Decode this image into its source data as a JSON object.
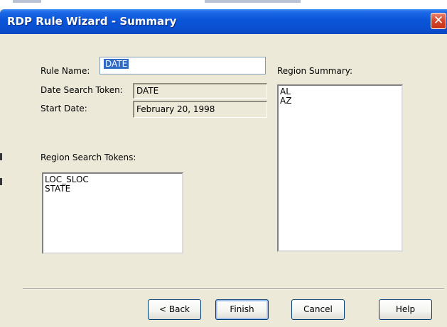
{
  "dialog": {
    "title": "RDP Rule Wizard - Summary",
    "close_glyph": "✕",
    "close_icon": "close-icon"
  },
  "fields": {
    "rule_name_label": "Rule Name:",
    "rule_name_value": "DATE",
    "date_search_token_label": "Date Search Token:",
    "date_search_token_value": "DATE",
    "start_date_label": "Start Date:",
    "start_date_value": "February 20, 1998"
  },
  "region_search_tokens": {
    "label": "Region Search Tokens:",
    "items": [
      "LOC_SLOC",
      "STATE"
    ]
  },
  "region_summary": {
    "label": "Region Summary:",
    "items": [
      "AL",
      "AZ"
    ]
  },
  "buttons": {
    "back": "< Back",
    "finish": "Finish",
    "cancel": "Cancel",
    "help": "Help"
  },
  "colors": {
    "titlebar": "#0a55d8",
    "dialog_bg": "#ece9d8",
    "selection": "#316ac5",
    "close": "#d5462b"
  }
}
